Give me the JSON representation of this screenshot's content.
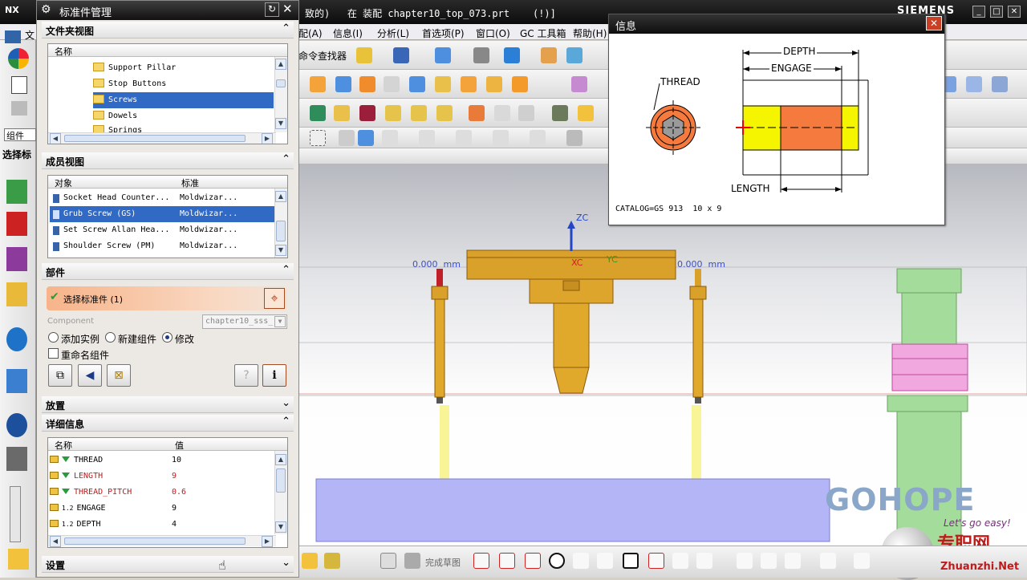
{
  "app_window": {
    "title": "致的)   在 装配 chapter10_top_073.prt    (!)]",
    "brand": "SIEMENS"
  },
  "menubar": {
    "items": [
      "配(A)",
      "信息(I)",
      "分析(L)",
      "首选项(P)",
      "窗口(O)",
      "GC 工具箱",
      "帮助(H)"
    ]
  },
  "toolbar": {
    "command_finder": "命令查找器",
    "finish_sketch": "完成草图"
  },
  "left_strip": {
    "item1": "文",
    "combo_value": "组件",
    "selection": "选择标"
  },
  "dialog": {
    "logo": "NX",
    "title": "标准件管理",
    "folder_view": {
      "section": "文件夹视图",
      "column": "名称",
      "items": [
        "Support Pillar",
        "Stop Buttons",
        "Screws",
        "Dowels",
        "Springs"
      ]
    },
    "member_view": {
      "section": "成员视图",
      "col_object": "对象",
      "col_standard": "标准",
      "rows": [
        {
          "object": "Socket Head Counter...",
          "standard": "Moldwizar..."
        },
        {
          "object": "Grub Screw (GS)",
          "standard": "Moldwizar..."
        },
        {
          "object": "Set Screw Allan Hea...",
          "standard": "Moldwizar..."
        },
        {
          "object": "Shoulder Screw (PM)",
          "standard": "Moldwizar..."
        }
      ]
    },
    "part": {
      "section": "部件",
      "select_label": "选择标准件 (1)",
      "component_label": "Component",
      "component_value": "chapter10_sss_",
      "radio_add": "添加实例",
      "radio_new": "新建组件",
      "radio_modify": "修改",
      "rename": "重命名组件"
    },
    "placement": {
      "section": "放置"
    },
    "details": {
      "section": "详细信息",
      "col_name": "名称",
      "col_value": "值",
      "rows": [
        {
          "name": "THREAD",
          "value": "10"
        },
        {
          "name": "LENGTH",
          "value": "9"
        },
        {
          "name": "THREAD_PITCH",
          "value": "0.6"
        },
        {
          "name": "ENGAGE",
          "value": "9"
        },
        {
          "name": "DEPTH",
          "value": "4"
        }
      ]
    },
    "settings": {
      "section": "设置"
    }
  },
  "info_window": {
    "title": "信息",
    "thread": "THREAD",
    "depth": "DEPTH",
    "engage": "ENGAGE",
    "length": "LENGTH",
    "catalog": "CATALOG=GS 913  10 x 9"
  },
  "viewport": {
    "axis_zc": "ZC",
    "axis_xc": "XC",
    "axis_yc": "YC",
    "dim_left": "0.000  mm",
    "dim_right": "0.000  mm"
  },
  "watermark": {
    "brand": "GOHOPE",
    "slogan": "Let's go easy!",
    "site_cn": "专职网",
    "site": "Zhuanzhi.Net"
  },
  "colors": {
    "selection": "#316ac5",
    "dialog_bg": "#ece9e4",
    "screw_orange": "#f47a3d",
    "thread_yellow": "#f5f500",
    "part_gold": "#d9a02a"
  }
}
